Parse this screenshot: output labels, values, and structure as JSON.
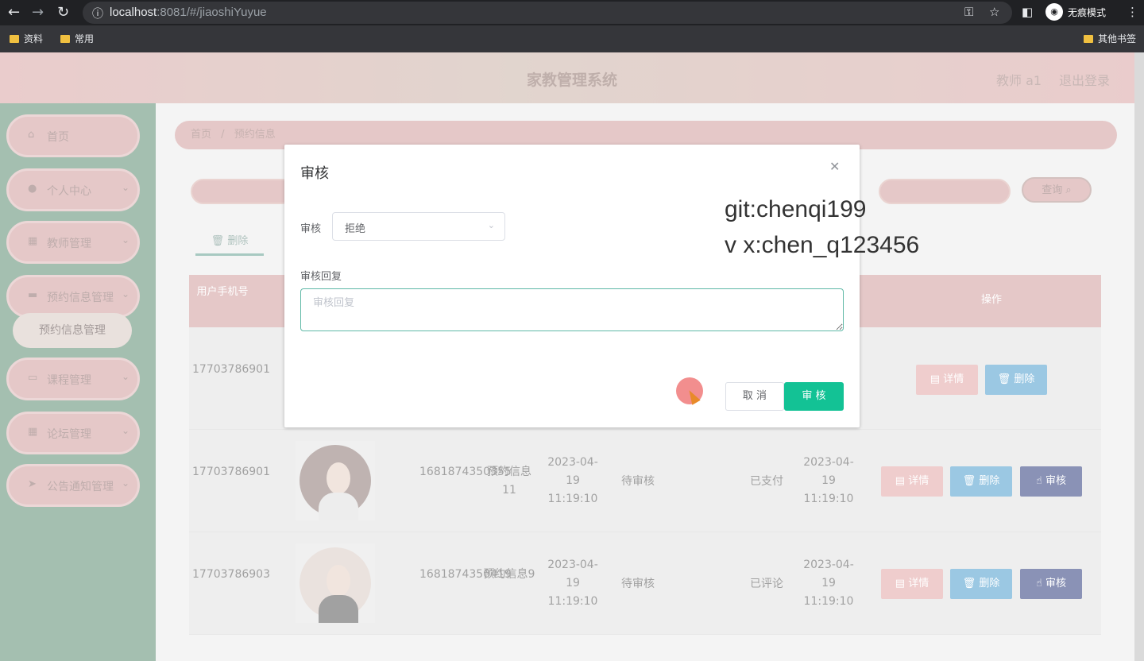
{
  "browser": {
    "url_host": "localhost",
    "url_rest": ":8081/#/jiaoshiYuyue",
    "incognito_label": "无痕模式",
    "bookmarks": [
      "资料",
      "常用"
    ],
    "other_bookmarks": "其他书签"
  },
  "header": {
    "title": "家教管理系统",
    "user": "教师 a1",
    "logout": "退出登录"
  },
  "sidebar": {
    "items": [
      {
        "label": "首页",
        "icon": "home-icon"
      },
      {
        "label": "个人中心",
        "icon": "user-icon"
      },
      {
        "label": "教师管理",
        "icon": "grid-icon"
      },
      {
        "label": "预约信息管理",
        "icon": "card-icon"
      },
      {
        "label": "课程管理",
        "icon": "book-icon"
      },
      {
        "label": "论坛管理",
        "icon": "grid-icon"
      },
      {
        "label": "公告通知管理",
        "icon": "send-icon"
      }
    ],
    "active_sub": "预约信息管理"
  },
  "breadcrumb": {
    "home": "首页",
    "sep": "/",
    "current": "预约信息"
  },
  "toolbar": {
    "query": "查询",
    "delete_tab": "删除"
  },
  "table": {
    "headers": {
      "phone": "用户手机号",
      "actions": "操作"
    },
    "rows": [
      {
        "phone": "17703786901",
        "actions": [
          "详情",
          "删除"
        ]
      },
      {
        "phone": "17703786901",
        "number": "1681874350355",
        "title": "预约信息11",
        "time": "2023-04-19 11:19:10",
        "audit_status": "待审核",
        "pay_status": "已支付",
        "audit_time": "2023-04-19 11:19:10",
        "actions": [
          "详情",
          "删除",
          "审核"
        ]
      },
      {
        "phone": "17703786903",
        "number": "1681874350419",
        "title": "预约信息9",
        "time": "2023-04-19 11:19:10",
        "audit_status": "待审核",
        "pay_status": "已评论",
        "audit_time": "2023-04-19 11:19:10",
        "actions": [
          "详情",
          "删除",
          "审核"
        ]
      }
    ]
  },
  "dialog": {
    "title": "审核",
    "audit_label": "审核",
    "audit_value": "拒绝",
    "reply_label": "审核回复",
    "reply_placeholder": "审核回复",
    "cancel": "取 消",
    "confirm": "审 核"
  },
  "watermark": {
    "line1": "git:chenqi199",
    "line2": "v x:chen_q123456"
  },
  "colors": {
    "sidebar": "#5a8b70",
    "header": "#d9a3a3",
    "accent": "#13c295",
    "delete_btn": "#4a9ccd",
    "audit_btn": "#2a3a7a"
  }
}
